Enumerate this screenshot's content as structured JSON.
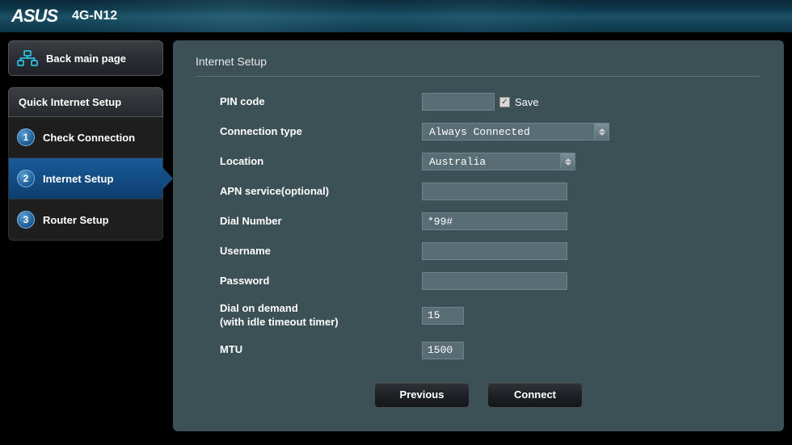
{
  "brand": "ASUS",
  "model": "4G-N12",
  "back_button": "Back main page",
  "qis_title": "Quick Internet Setup",
  "steps": [
    {
      "num": "1",
      "label": "Check Connection"
    },
    {
      "num": "2",
      "label": "Internet Setup"
    },
    {
      "num": "3",
      "label": "Router Setup"
    }
  ],
  "active_step": 1,
  "panel_title": "Internet Setup",
  "form": {
    "pin": {
      "label": "PIN code",
      "value": "",
      "save_checked": true,
      "save_text": "Save"
    },
    "connection_type": {
      "label": "Connection type",
      "value": "Always Connected"
    },
    "location": {
      "label": "Location",
      "value": "Australia"
    },
    "apn": {
      "label": "APN service(optional)",
      "value": ""
    },
    "dial_number": {
      "label": "Dial Number",
      "value": "*99#"
    },
    "username": {
      "label": "Username",
      "value": ""
    },
    "password": {
      "label": "Password",
      "value": ""
    },
    "dial_on_demand": {
      "label": "Dial on demand\n(with idle timeout timer)",
      "value": "15"
    },
    "mtu": {
      "label": "MTU",
      "value": "1500"
    }
  },
  "buttons": {
    "prev": "Previous",
    "next": "Connect"
  }
}
